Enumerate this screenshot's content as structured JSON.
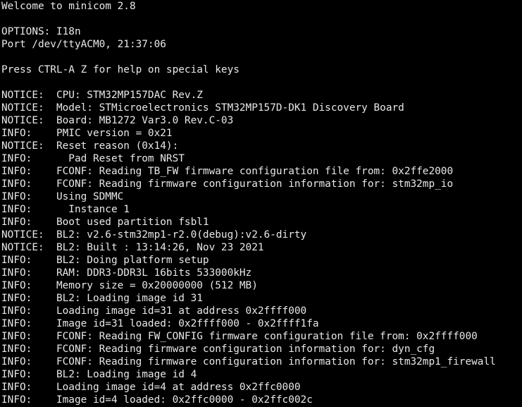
{
  "terminal": {
    "lines": [
      "Welcome to minicom 2.8",
      "",
      "OPTIONS: I18n",
      "Port /dev/ttyACM0, 21:37:06",
      "",
      "Press CTRL-A Z for help on special keys",
      "",
      "NOTICE:  CPU: STM32MP157DAC Rev.Z",
      "NOTICE:  Model: STMicroelectronics STM32MP157D-DK1 Discovery Board",
      "NOTICE:  Board: MB1272 Var3.0 Rev.C-03",
      "INFO:    PMIC version = 0x21",
      "NOTICE:  Reset reason (0x14):",
      "INFO:      Pad Reset from NRST",
      "INFO:    FCONF: Reading TB_FW firmware configuration file from: 0x2ffe2000",
      "INFO:    FCONF: Reading firmware configuration information for: stm32mp_io",
      "INFO:    Using SDMMC",
      "INFO:      Instance 1",
      "INFO:    Boot used partition fsbl1",
      "NOTICE:  BL2: v2.6-stm32mp1-r2.0(debug):v2.6-dirty",
      "NOTICE:  BL2: Built : 13:14:26, Nov 23 2021",
      "INFO:    BL2: Doing platform setup",
      "INFO:    RAM: DDR3-DDR3L 16bits 533000kHz",
      "INFO:    Memory size = 0x20000000 (512 MB)",
      "INFO:    BL2: Loading image id 31",
      "INFO:    Loading image id=31 at address 0x2ffff000",
      "INFO:    Image id=31 loaded: 0x2ffff000 - 0x2ffff1fa",
      "INFO:    FCONF: Reading FW_CONFIG firmware configuration file from: 0x2ffff000",
      "INFO:    FCONF: Reading firmware configuration information for: dyn_cfg",
      "INFO:    FCONF: Reading firmware configuration information for: stm32mp1_firewall",
      "INFO:    BL2: Loading image id 4",
      "INFO:    Loading image id=4 at address 0x2ffc0000",
      "INFO:    Image id=4 loaded: 0x2ffc0000 - 0x2ffc002c"
    ]
  }
}
